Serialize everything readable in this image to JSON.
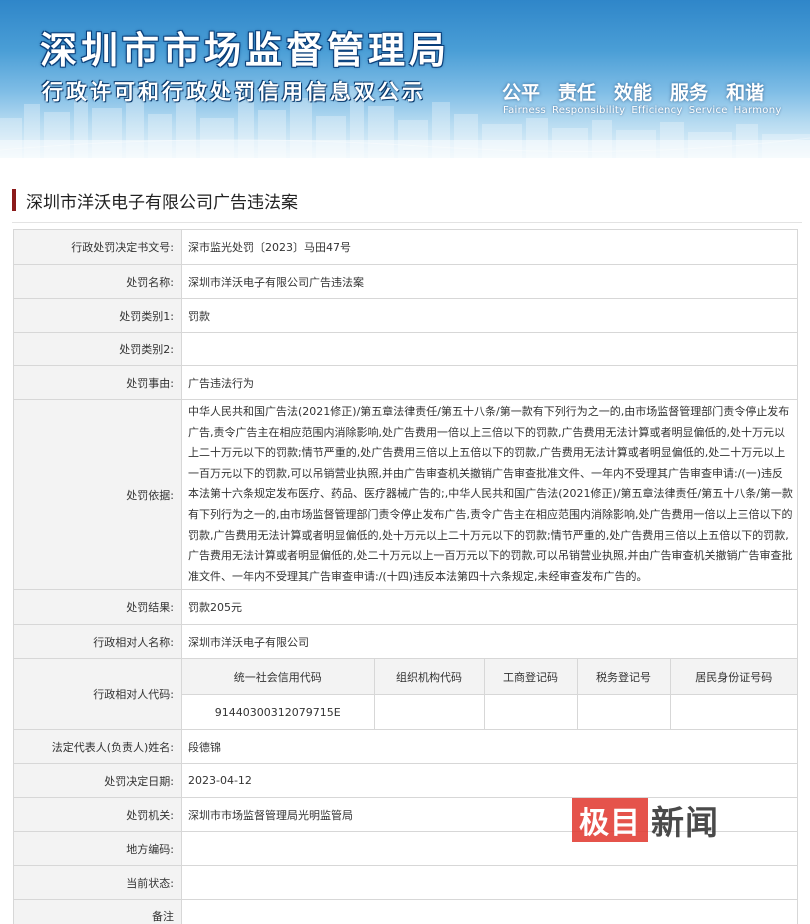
{
  "banner": {
    "title": "深圳市市场监督管理局",
    "subtitle": "行政许可和行政处罚信用信息双公示",
    "motto_cn": [
      "公平",
      "责任",
      "效能",
      "服务",
      "和谐"
    ],
    "motto_en": [
      "Fairness",
      "Responsibility",
      "Efficiency",
      "Service",
      "Harmony"
    ]
  },
  "heading": "深圳市洋沃电子有限公司广告违法案",
  "rows": {
    "doc_no": {
      "label": "行政处罚决定书文号:",
      "value": "深市监光处罚〔2023〕马田47号"
    },
    "case_name": {
      "label": "处罚名称:",
      "value": "深圳市洋沃电子有限公司广告违法案"
    },
    "category1": {
      "label": "处罚类别1:",
      "value": "罚款"
    },
    "category2": {
      "label": "处罚类别2:",
      "value": ""
    },
    "reason": {
      "label": "处罚事由:",
      "value": "广告违法行为"
    },
    "basis": {
      "label": "处罚依据:",
      "value": "中华人民共和国广告法(2021修正)/第五章法律责任/第五十八条/第一款有下列行为之一的,由市场监督管理部门责令停止发布广告,责令广告主在相应范围内消除影响,处广告费用一倍以上三倍以下的罚款,广告费用无法计算或者明显偏低的,处十万元以上二十万元以下的罚款;情节严重的,处广告费用三倍以上五倍以下的罚款,广告费用无法计算或者明显偏低的,处二十万元以上一百万元以下的罚款,可以吊销营业执照,并由广告审查机关撤销广告审查批准文件、一年内不受理其广告审查申请:/(一)违反本法第十六条规定发布医疗、药品、医疗器械广告的;,中华人民共和国广告法(2021修正)/第五章法律责任/第五十八条/第一款有下列行为之一的,由市场监督管理部门责令停止发布广告,责令广告主在相应范围内消除影响,处广告费用一倍以上三倍以下的罚款,广告费用无法计算或者明显偏低的,处十万元以上二十万元以下的罚款;情节严重的,处广告费用三倍以上五倍以下的罚款,广告费用无法计算或者明显偏低的,处二十万元以上一百万元以下的罚款,可以吊销营业执照,并由广告审查机关撤销广告审查批准文件、一年内不受理其广告审查申请:/(十四)违反本法第四十六条规定,未经审查发布广告的。"
    },
    "result": {
      "label": "处罚结果:",
      "value": "罚款205元"
    },
    "party_name": {
      "label": "行政相对人名称:",
      "value": "深圳市洋沃电子有限公司"
    },
    "party_code": {
      "label": "行政相对人代码:"
    },
    "legal_rep": {
      "label": "法定代表人(负责人)姓名:",
      "value": "段德锦"
    },
    "decision_date": {
      "label": "处罚决定日期:",
      "value": "2023-04-12"
    },
    "authority": {
      "label": "处罚机关:",
      "value": "深圳市市场监督管理局光明监管局"
    },
    "region_code": {
      "label": "地方编码:",
      "value": ""
    },
    "status": {
      "label": "当前状态:",
      "value": ""
    },
    "remark": {
      "label": "备注",
      "value": ""
    }
  },
  "codes": {
    "headers": [
      "统一社会信用代码",
      "组织机构代码",
      "工商登记码",
      "税务登记号",
      "居民身份证号码"
    ],
    "values": [
      "91440300312079715E",
      "",
      "",
      "",
      ""
    ]
  },
  "watermark": {
    "box": "极目",
    "word": "新闻"
  },
  "colors": {
    "accent_bar": "#8b1a1a",
    "label_bg": "#f3f3f3",
    "border": "#d7d7d7",
    "watermark_red": "#e23c33"
  }
}
